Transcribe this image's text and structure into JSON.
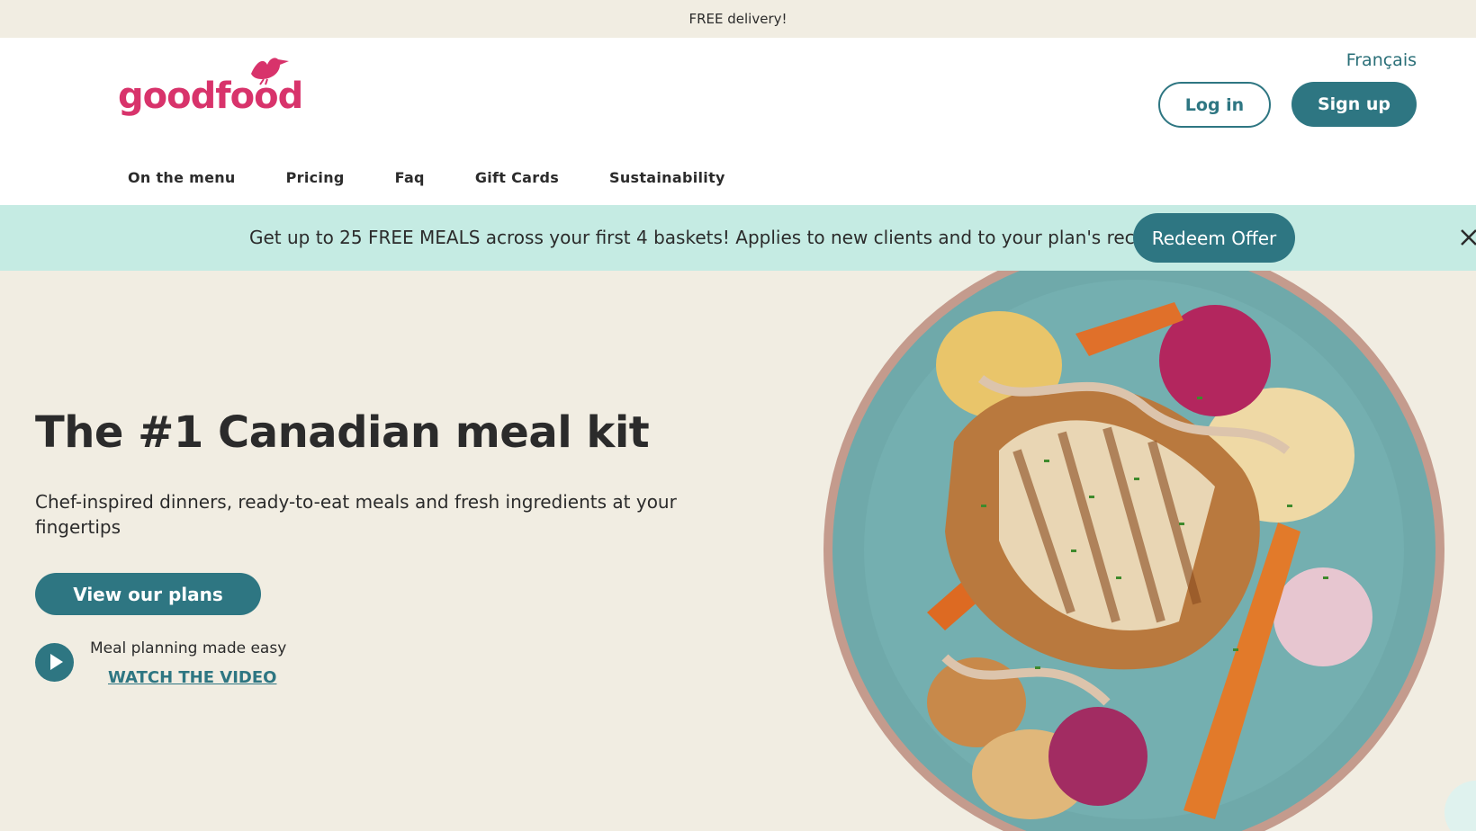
{
  "announcement": "FREE delivery!",
  "brand": {
    "name": "goodfood",
    "accent": "#d8336b",
    "primary": "#2e7682"
  },
  "header": {
    "language_label": "Français",
    "login_label": "Log in",
    "signup_label": "Sign up"
  },
  "nav": {
    "items": [
      {
        "label": "On the menu"
      },
      {
        "label": "Pricing"
      },
      {
        "label": "Faq"
      },
      {
        "label": "Gift Cards"
      },
      {
        "label": "Sustainability"
      }
    ]
  },
  "promo": {
    "text": "Get up to 25 FREE MEALS across your first 4 baskets! Applies to new clients and to your plan's recipes.",
    "button_label": "Redeem Offer",
    "close_icon": "close-icon"
  },
  "hero": {
    "title": "The #1 Canadian meal kit",
    "subtitle": "Chef-inspired dinners, ready-to-eat meals and fresh ingredients at your fingertips",
    "cta_label": "View our plans",
    "video_caption": "Meal planning made easy",
    "video_link": "WATCH THE VIDEO",
    "image": "plate-of-sliced-chicken-with-roasted-vegetables"
  }
}
